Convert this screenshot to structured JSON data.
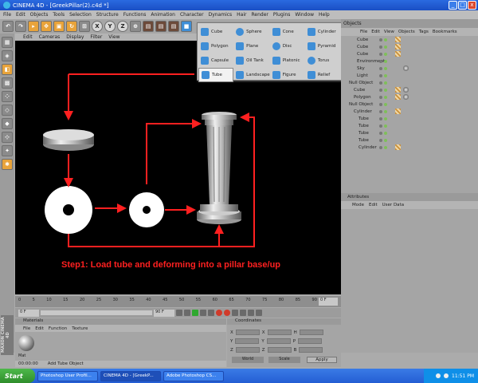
{
  "window": {
    "title": "CINEMA 4D - [GreekPillar(2).c4d *]",
    "window_buttons": [
      "_",
      "□",
      "x"
    ]
  },
  "menu": [
    "File",
    "Edit",
    "Objects",
    "Tools",
    "Selection",
    "Structure",
    "Functions",
    "Animation",
    "Character",
    "Dynamics",
    "Hair",
    "Render",
    "Plugins",
    "Window",
    "Help"
  ],
  "toolbar": {
    "axis_buttons": [
      "X",
      "Y",
      "Z"
    ]
  },
  "viewport": {
    "menu": [
      "Edit",
      "Cameras",
      "Display",
      "Filter",
      "View"
    ],
    "annotation": "Step1: Load tube and  deforming into a pillar base/up",
    "accent": "#FF2020"
  },
  "primitive_menu": {
    "items": [
      "Cube",
      "Sphere",
      "Cone",
      "Cylinder",
      "Polygon",
      "Plane",
      "Disc",
      "Pyramid",
      "Capsule",
      "Oil Tank",
      "Platonic",
      "Torus",
      "Tube",
      "Landscape",
      "Figure",
      "Relief"
    ],
    "selected": "Tube"
  },
  "objects_panel": {
    "title": "Objects",
    "menu": [
      "File",
      "Edit",
      "View",
      "Objects",
      "Tags",
      "Bookmarks"
    ],
    "rows": [
      "Cube",
      "Cube",
      "Cube",
      "Environment",
      "Sky",
      "Light",
      "Null Object",
      "Cube",
      "Polygon",
      "Null Object",
      "Cylinder",
      "Tube",
      "Tube",
      "Tube",
      "Tube",
      "Cylinder"
    ]
  },
  "attributes_panel": {
    "title": "Attributes",
    "menu": [
      "Mode",
      "Edit",
      "User Data"
    ]
  },
  "timeline": {
    "ticks": [
      "0",
      "5",
      "10",
      "15",
      "20",
      "25",
      "30",
      "35",
      "40",
      "45",
      "50",
      "55",
      "60",
      "65",
      "70",
      "75",
      "80",
      "85",
      "90"
    ],
    "frame": "0 F",
    "start": "0 F",
    "end": "90 F"
  },
  "material_manager": {
    "title": "Materials",
    "menu": [
      "File",
      "Edit",
      "Function",
      "Texture"
    ],
    "material": "Mat"
  },
  "status": {
    "time": "00:00:00",
    "message": "Add Tube Object"
  },
  "coordinates": {
    "title": "Coordinates",
    "axes": [
      "X",
      "Y",
      "Z"
    ],
    "rot_axes": [
      "H",
      "P",
      "B"
    ],
    "mode": "World",
    "scale": "Scale",
    "apply": "Apply"
  },
  "taskbar": {
    "start": "Start",
    "tasks": [
      "Photoshop User Profil...",
      "CINEMA 4D - [GreekP...",
      "Adobe Photoshop CS..."
    ],
    "clock": "11:51 PM"
  }
}
